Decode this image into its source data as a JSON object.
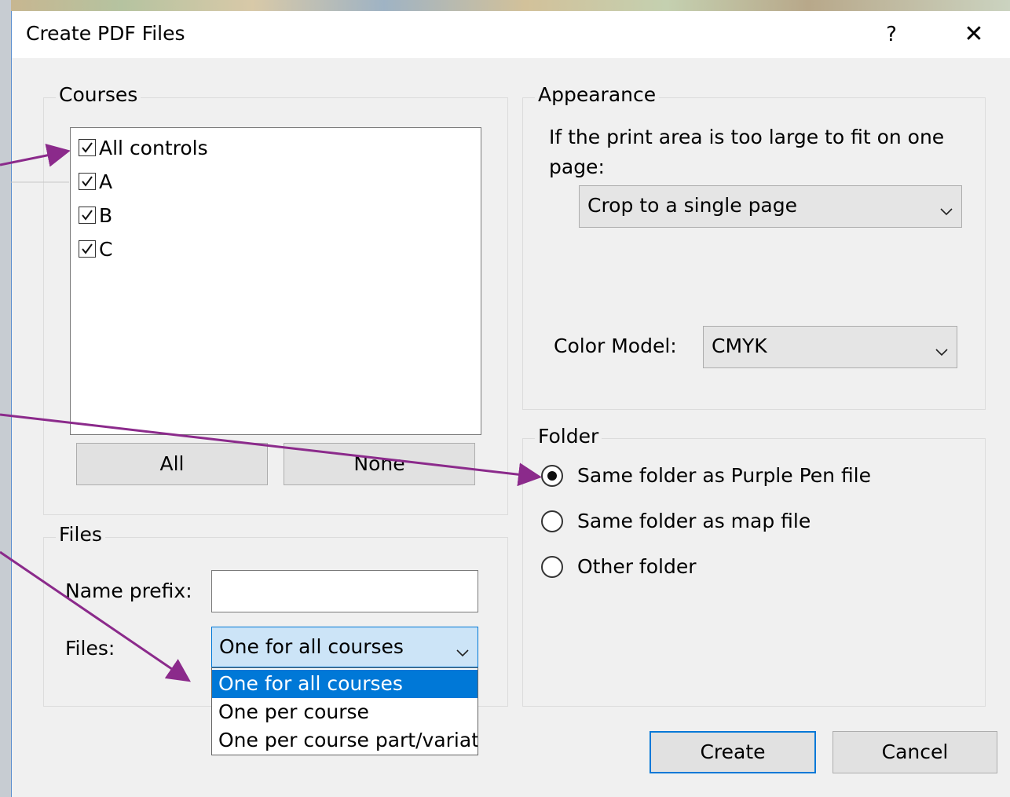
{
  "dialog": {
    "title": "Create PDF Files",
    "help": "?",
    "close": "✕"
  },
  "courses": {
    "legend": "Courses",
    "items": [
      {
        "label": "All controls",
        "checked": true
      },
      {
        "label": "A",
        "checked": true
      },
      {
        "label": "B",
        "checked": true
      },
      {
        "label": "C",
        "checked": true
      }
    ],
    "all_button": "All",
    "none_button": "None"
  },
  "files": {
    "legend": "Files",
    "name_prefix_label": "Name prefix:",
    "name_prefix_value": "",
    "files_label": "Files:",
    "files_selected": "One for all courses",
    "options": [
      "One for all courses",
      "One per course",
      "One per course part/variat"
    ]
  },
  "appearance": {
    "legend": "Appearance",
    "fit_text": "If the print area is too large to fit on one page:",
    "fit_selected": "Crop to a single page",
    "color_model_label": "Color Model:",
    "color_model_selected": "CMYK"
  },
  "folder": {
    "legend": "Folder",
    "options": [
      {
        "label": "Same folder as Purple Pen file",
        "selected": true
      },
      {
        "label": "Same folder as map file",
        "selected": false
      },
      {
        "label": "Other folder",
        "selected": false
      }
    ]
  },
  "buttons": {
    "create": "Create",
    "cancel": "Cancel"
  },
  "colors": {
    "accent": "#0078d7",
    "annotation_arrow": "#8b2a8b"
  }
}
